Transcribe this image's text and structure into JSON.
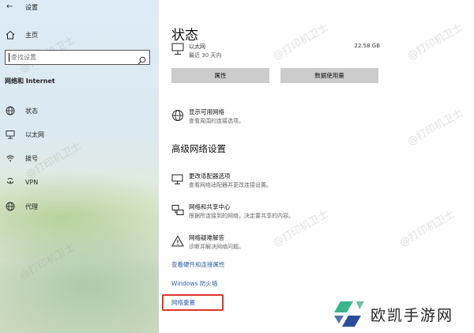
{
  "window": {
    "title": "设置"
  },
  "sidebar": {
    "home_label": "主页",
    "search_placeholder": "查找设置",
    "section_title": "网络和 Internet",
    "items": [
      {
        "label": "状态",
        "icon": "globe-icon"
      },
      {
        "label": "以太网",
        "icon": "ethernet-icon"
      },
      {
        "label": "拨号",
        "icon": "dialup-icon"
      },
      {
        "label": "VPN",
        "icon": "vpn-icon"
      },
      {
        "label": "代理",
        "icon": "proxy-globe-icon"
      }
    ]
  },
  "main": {
    "page_title": "状态",
    "ethernet": {
      "name": "以太网",
      "since": "最近 30 天内",
      "usage": "22.58 GB"
    },
    "buttons": {
      "properties": "属性",
      "data_usage": "数据使用量"
    },
    "show_networks": {
      "title": "显示可用网络",
      "subtitle": "查看周围的连接选项。"
    },
    "advanced_heading": "高级网络设置",
    "advanced_items": [
      {
        "title": "更改适配器选项",
        "subtitle": "查看网络适配器并更改连接设置。",
        "icon": "adapter-icon"
      },
      {
        "title": "网络和共享中心",
        "subtitle": "根据所连接到的网络，决定要共享的内容。",
        "icon": "sharing-center-icon"
      },
      {
        "title": "网络疑难解答",
        "subtitle": "诊断并解决网络问题。",
        "icon": "warning-icon"
      }
    ],
    "links": {
      "hardware": "查看硬件和连接属性",
      "firewall": "Windows 防火墙",
      "reset": "网络重置"
    }
  },
  "watermark": "@打印机卫士",
  "brand": {
    "text": "欧凯手游网"
  },
  "colors": {
    "link": "#2a5fa8",
    "highlight": "#e0352b",
    "button_bg": "#cccccc"
  }
}
